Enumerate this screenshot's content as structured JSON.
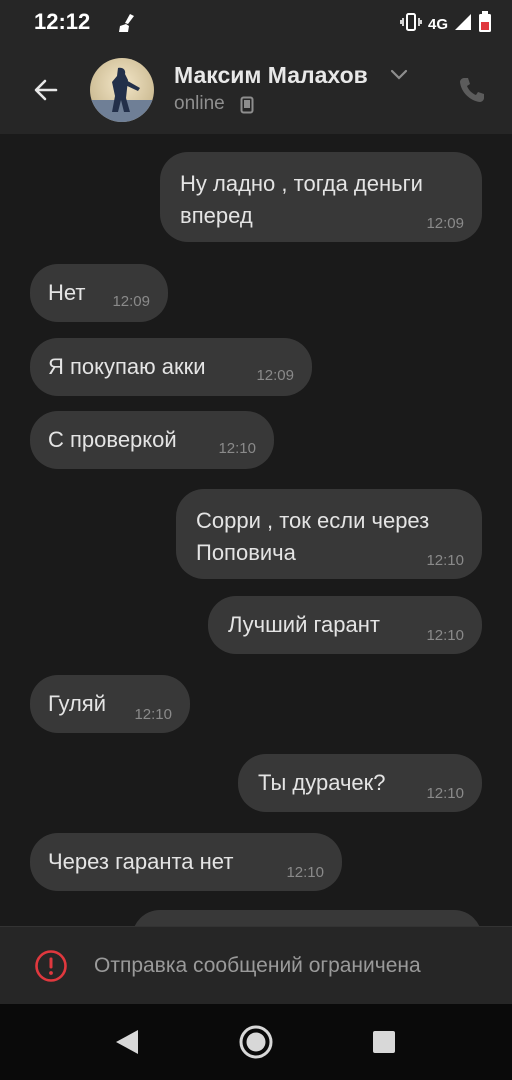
{
  "status_bar": {
    "time": "12:12",
    "network": "4G"
  },
  "header": {
    "contact_name": "Максим Малахов",
    "contact_status": "online"
  },
  "messages": [
    {
      "side": "out",
      "text": "Ну ладно , тогда деньги\nвперед",
      "time": "12:09"
    },
    {
      "side": "in",
      "text": "Нет",
      "time": "12:09"
    },
    {
      "side": "in",
      "text": "Я покупаю акки",
      "time": "12:09"
    },
    {
      "side": "in",
      "text": "С проверкой",
      "time": "12:10"
    },
    {
      "side": "out",
      "text": "Сорри , ток если через\nПоповича",
      "time": "12:10"
    },
    {
      "side": "out",
      "text": "Лучший гарант",
      "time": "12:10"
    },
    {
      "side": "in",
      "text": "Гуляй",
      "time": "12:10"
    },
    {
      "side": "out",
      "text": "Ты дурачек?",
      "time": "12:10"
    },
    {
      "side": "in",
      "text": "Через гаранта нет",
      "time": "12:10"
    }
  ],
  "restricted": {
    "text": "Отправка сообщений ограничена"
  },
  "colors": {
    "background": "#1a1a1a",
    "bar": "#262626",
    "bubble": "#383838",
    "alert": "#e0383e"
  },
  "icons": {
    "back": "arrow-left-icon",
    "call": "phone-icon",
    "alert": "exclamation-circle-icon",
    "nav_back": "triangle-back-icon",
    "nav_home": "circle-home-icon",
    "nav_recent": "square-recents-icon"
  }
}
